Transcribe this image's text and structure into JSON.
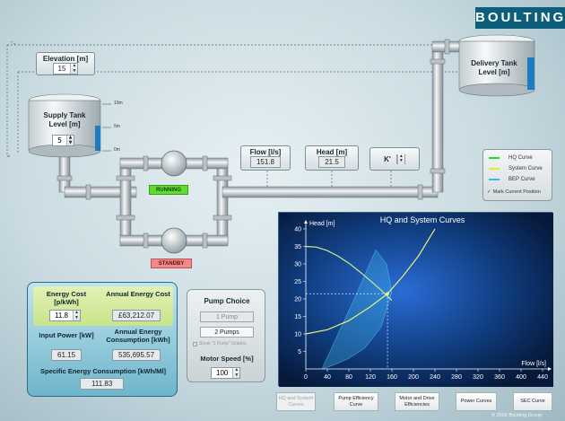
{
  "brand": "BOULTING",
  "elevation": {
    "label": "Elevation [m]",
    "value": "15"
  },
  "supply_tank": {
    "label": "Supply Tank Level [m]",
    "value": "5",
    "scale": [
      "10m",
      "5m",
      "0m"
    ]
  },
  "delivery_tank": {
    "label": "Delivery Tank Level [m]"
  },
  "pumps": {
    "running": "RUNNING",
    "standby": "STANDBY"
  },
  "flow": {
    "label": "Flow [l/s]",
    "value": "151.8"
  },
  "head": {
    "label": "Head [m]",
    "value": "21.5"
  },
  "k": {
    "label": "K'"
  },
  "legend": {
    "items": [
      {
        "label": "HQ Curve",
        "color": "#22dd22"
      },
      {
        "label": "System Curve",
        "color": "#e8ee22"
      },
      {
        "label": "BEP Curve",
        "color": "#33bbee"
      }
    ],
    "checkbox": "Mark Current Position"
  },
  "chart_data": {
    "type": "line",
    "title": "HQ and System Curves",
    "xlabel": "Flow [l/s]",
    "ylabel": "Head [m]",
    "xlim": [
      0,
      440
    ],
    "ylim": [
      0,
      40
    ],
    "x_ticks": [
      "0",
      "40",
      "80",
      "120",
      "160",
      "200",
      "240",
      "280",
      "320",
      "360",
      "400",
      "440"
    ],
    "y_ticks": [
      "5",
      "10",
      "15",
      "20",
      "25",
      "30",
      "35",
      "40"
    ],
    "series": [
      {
        "name": "HQ Curve",
        "color": "#c8f08a",
        "x": [
          0,
          20,
          40,
          60,
          80,
          100,
          120,
          140,
          160
        ],
        "y": [
          35,
          34.8,
          33.8,
          32.2,
          30.2,
          27.8,
          25.2,
          22.5,
          19.6
        ]
      },
      {
        "name": "System Curve",
        "color": "#e8f27a",
        "x": [
          0,
          40,
          80,
          120,
          151.8,
          180,
          210,
          240
        ],
        "y": [
          10,
          11.2,
          13.8,
          17.8,
          21.5,
          26.4,
          32.4,
          40
        ]
      }
    ],
    "operating_point": {
      "x": 151.8,
      "y": 21.5
    },
    "bep_band": {
      "upper": {
        "x": [
          30,
          60,
          90,
          110,
          130,
          150,
          160
        ],
        "y": [
          0,
          10,
          20,
          27,
          34,
          30,
          22
        ]
      },
      "lower": {
        "x": [
          160,
          140,
          110,
          80,
          50,
          30
        ],
        "y": [
          22,
          12,
          6,
          3,
          1,
          0
        ]
      }
    }
  },
  "energy": {
    "cost_label": "Energy Cost [p/kWh]",
    "cost_value": "11.8",
    "annual_cost_label": "Annual Energy Cost",
    "annual_cost_value": "£63,212.07",
    "input_power_label": "Input Power [kW]",
    "input_power_value": "61.15",
    "annual_consumption_label": "Annual Energy Consumption [kWh]",
    "annual_consumption_value": "535,695.57",
    "sec_label": "Specific Energy Consumption [kWh/Ml]",
    "sec_value": "111.83"
  },
  "pump_choice": {
    "title": "Pump Choice",
    "one_pump": "1 Pump",
    "two_pumps": "2 Pumps",
    "show_curves": "Show \"1 Pump\" Graphs",
    "motor_speed_label": "Motor Speed [%]",
    "motor_speed_value": "100"
  },
  "tabs": [
    "HQ and System Curves",
    "Pump Efficiency Curve",
    "Motor and Drive Efficiencies",
    "Power Curves",
    "SEC Curve"
  ],
  "copyright": "© 2009 Boulting Group"
}
